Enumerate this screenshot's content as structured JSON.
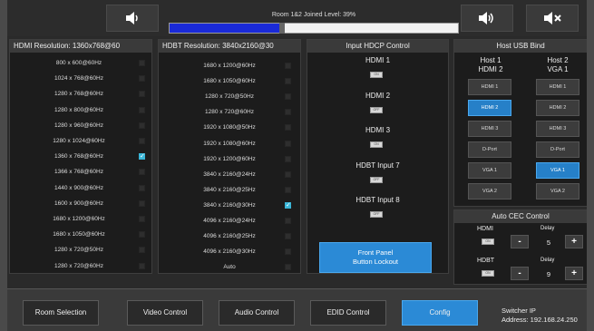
{
  "header": {
    "volume_label": "Room 1&2 Joined Level: 39%",
    "volume_percent": 39,
    "icons": [
      "volume-down-icon",
      "volume-up-icon",
      "mute-icon"
    ]
  },
  "hdmi_panel": {
    "title": "HDMI Resolution: 1360x768@60",
    "resolutions": [
      {
        "label": "800 x 600@60Hz",
        "checked": false
      },
      {
        "label": "1024 x 768@60Hz",
        "checked": false
      },
      {
        "label": "1280 x 768@60Hz",
        "checked": false
      },
      {
        "label": "1280 x 800@60Hz",
        "checked": false
      },
      {
        "label": "1280 x 960@60Hz",
        "checked": false
      },
      {
        "label": "1280 x 1024@60Hz",
        "checked": false
      },
      {
        "label": "1360 x 768@60Hz",
        "checked": true
      },
      {
        "label": "1366 x 768@60Hz",
        "checked": false
      },
      {
        "label": "1440 x 900@60Hz",
        "checked": false
      },
      {
        "label": "1600 x 900@60Hz",
        "checked": false
      },
      {
        "label": "1680 x 1200@60Hz",
        "checked": false
      },
      {
        "label": "1680 x 1050@60Hz",
        "checked": false
      },
      {
        "label": "1280 x 720@50Hz",
        "checked": false
      },
      {
        "label": "1280 x 720@60Hz",
        "checked": false
      }
    ]
  },
  "hdbt_panel": {
    "title": "HDBT Resolution: 3840x2160@30",
    "resolutions": [
      {
        "label": "1680 x 1200@60Hz",
        "checked": false
      },
      {
        "label": "1680 x 1050@60Hz",
        "checked": false
      },
      {
        "label": "1280 x 720@50Hz",
        "checked": false
      },
      {
        "label": "1280 x 720@60Hz",
        "checked": false
      },
      {
        "label": "1920 x 1080@50Hz",
        "checked": false
      },
      {
        "label": "1920 x 1080@60Hz",
        "checked": false
      },
      {
        "label": "1920 x 1200@60Hz",
        "checked": false
      },
      {
        "label": "3840 x 2160@24Hz",
        "checked": false
      },
      {
        "label": "3840 x 2160@25Hz",
        "checked": false
      },
      {
        "label": "3840 x 2160@30Hz",
        "checked": true
      },
      {
        "label": "4096 x 2160@24Hz",
        "checked": false
      },
      {
        "label": "4096 x 2160@25Hz",
        "checked": false
      },
      {
        "label": "4096 x 2160@30Hz",
        "checked": false
      },
      {
        "label": "Auto",
        "checked": false
      }
    ]
  },
  "hdcp_panel": {
    "title": "Input HDCP Control",
    "inputs": [
      {
        "label": "HDMI 1",
        "state": "ON"
      },
      {
        "label": "HDMI 2",
        "state": "OFF"
      },
      {
        "label": "HDMI 3",
        "state": "ON"
      },
      {
        "label": "HDBT Input 7",
        "state": "OFF"
      },
      {
        "label": "HDBT Input 8",
        "state": "OFF"
      }
    ],
    "front_panel_line1": "Front Panel",
    "front_panel_line2": "Button Lockout"
  },
  "usb_panel": {
    "title": "Host USB Bind",
    "host1_line1": "Host 1",
    "host1_line2": "HDMI 2",
    "host2_line1": "Host 2",
    "host2_line2": "VGA 1",
    "host1_buttons": [
      "HDMI 1",
      "HDMI 2",
      "HDMI 3",
      "D-Port",
      "VGA 1",
      "VGA 2"
    ],
    "host1_active": 1,
    "host2_buttons": [
      "HDMI 1",
      "HDMI 2",
      "HDMI 3",
      "D-Port",
      "VGA 1",
      "VGA 2"
    ],
    "host2_active": 4
  },
  "cec_panel": {
    "title": "Auto CEC Control",
    "hdmi_label": "HDMI",
    "hdbt_label": "HDBT",
    "delay_label": "Delay",
    "hdmi_state": "ON",
    "hdbt_state": "ON",
    "hdmi_delay": "5",
    "hdbt_delay": "9",
    "minus": "-",
    "plus": "+"
  },
  "nav": {
    "room_selection": "Room Selection",
    "video_control": "Video Control",
    "audio_control": "Audio Control",
    "edid_control": "EDID Control",
    "config": "Config",
    "switcher_line1": "Switcher IP",
    "switcher_line2": "Address: 192.168.24.250"
  }
}
